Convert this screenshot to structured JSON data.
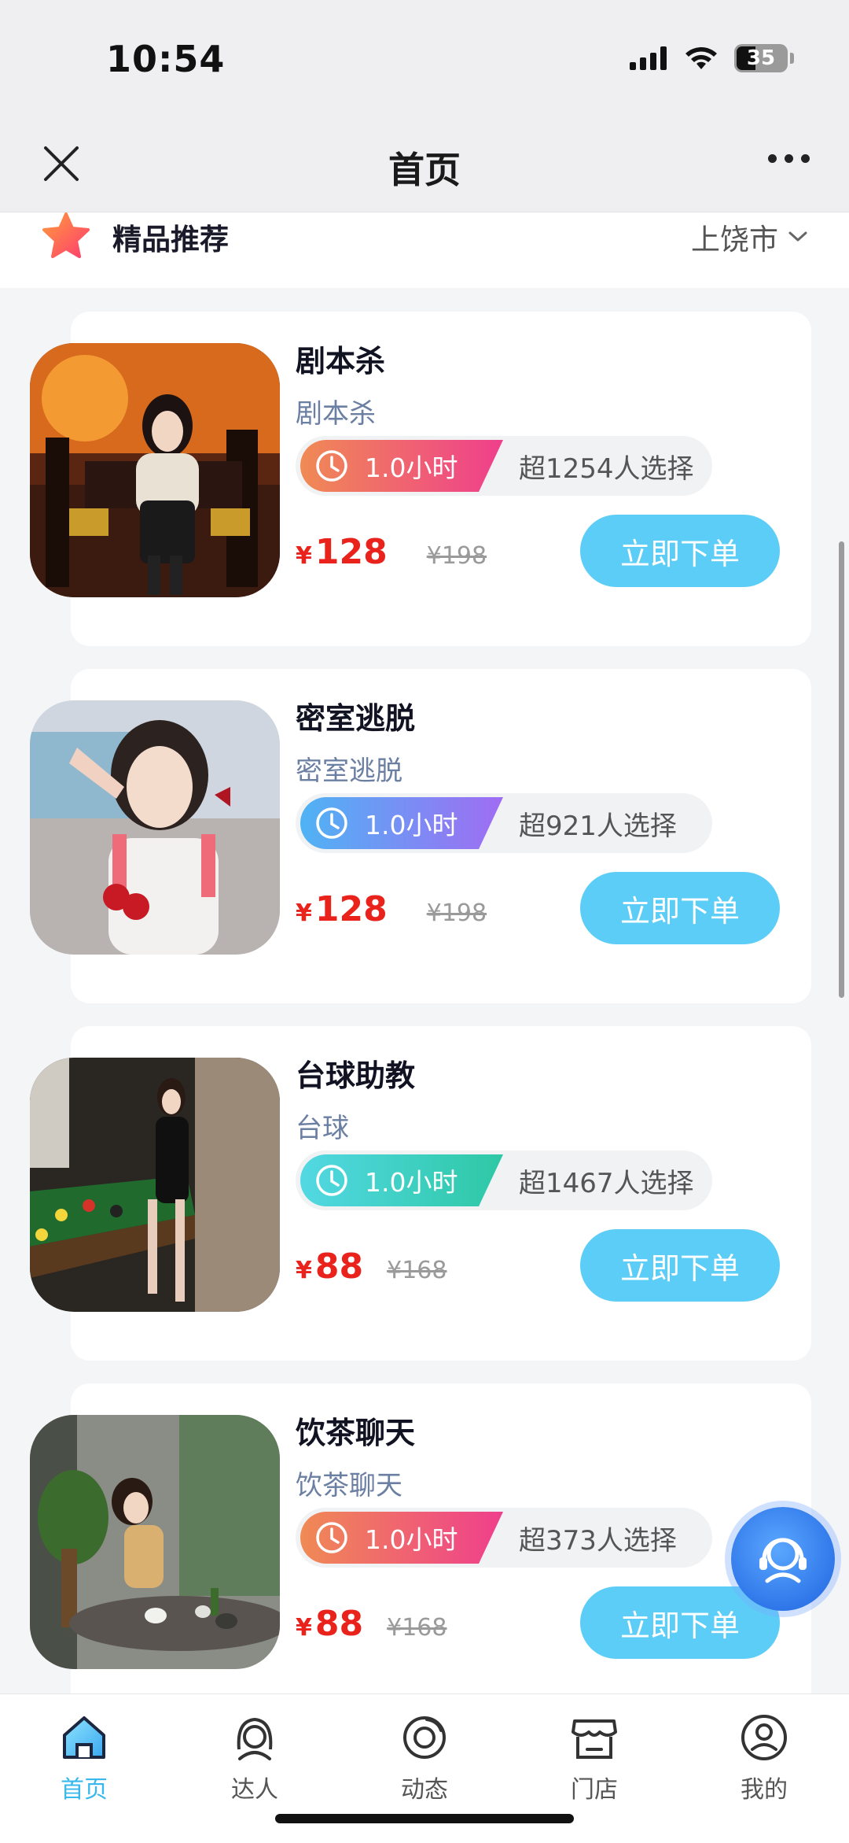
{
  "status_bar": {
    "time": "10:54",
    "battery": "35"
  },
  "nav": {
    "title": "首页"
  },
  "section": {
    "title": "精品推荐",
    "city": "上饶市"
  },
  "cards": [
    {
      "title": "剧本杀",
      "subtitle": "剧本杀",
      "duration": "1.0小时",
      "chosen": "超1254人选择",
      "currency": "¥",
      "price": "128",
      "original_price": "¥198",
      "button": "立即下单",
      "badge_colors": [
        "#f08a55",
        "#ef3f8c"
      ]
    },
    {
      "title": "密室逃脱",
      "subtitle": "密室逃脱",
      "duration": "1.0小时",
      "chosen": "超921人选择",
      "currency": "¥",
      "price": "128",
      "original_price": "¥198",
      "button": "立即下单",
      "badge_colors": [
        "#4fb3f4",
        "#a06cf3"
      ]
    },
    {
      "title": "台球助教",
      "subtitle": "台球",
      "duration": "1.0小时",
      "chosen": "超1467人选择",
      "currency": "¥",
      "price": "88",
      "original_price": "¥168",
      "button": "立即下单",
      "badge_colors": [
        "#52d8e3",
        "#2ec8a5"
      ]
    },
    {
      "title": "饮茶聊天",
      "subtitle": "饮茶聊天",
      "duration": "1.0小时",
      "chosen": "超373人选择",
      "currency": "¥",
      "price": "88",
      "original_price": "¥168",
      "button": "立即下单",
      "badge_colors": [
        "#f08a55",
        "#ef3f8c"
      ]
    }
  ],
  "tabs": [
    {
      "label": "首页",
      "icon": "home-icon",
      "active": true
    },
    {
      "label": "达人",
      "icon": "person-icon",
      "active": false
    },
    {
      "label": "动态",
      "icon": "moments-icon",
      "active": false
    },
    {
      "label": "门店",
      "icon": "store-icon",
      "active": false
    },
    {
      "label": "我的",
      "icon": "profile-icon",
      "active": false
    }
  ],
  "colors": {
    "accent": "#38b8ec",
    "button": "#5ccdf6",
    "price": "#e9231c"
  }
}
